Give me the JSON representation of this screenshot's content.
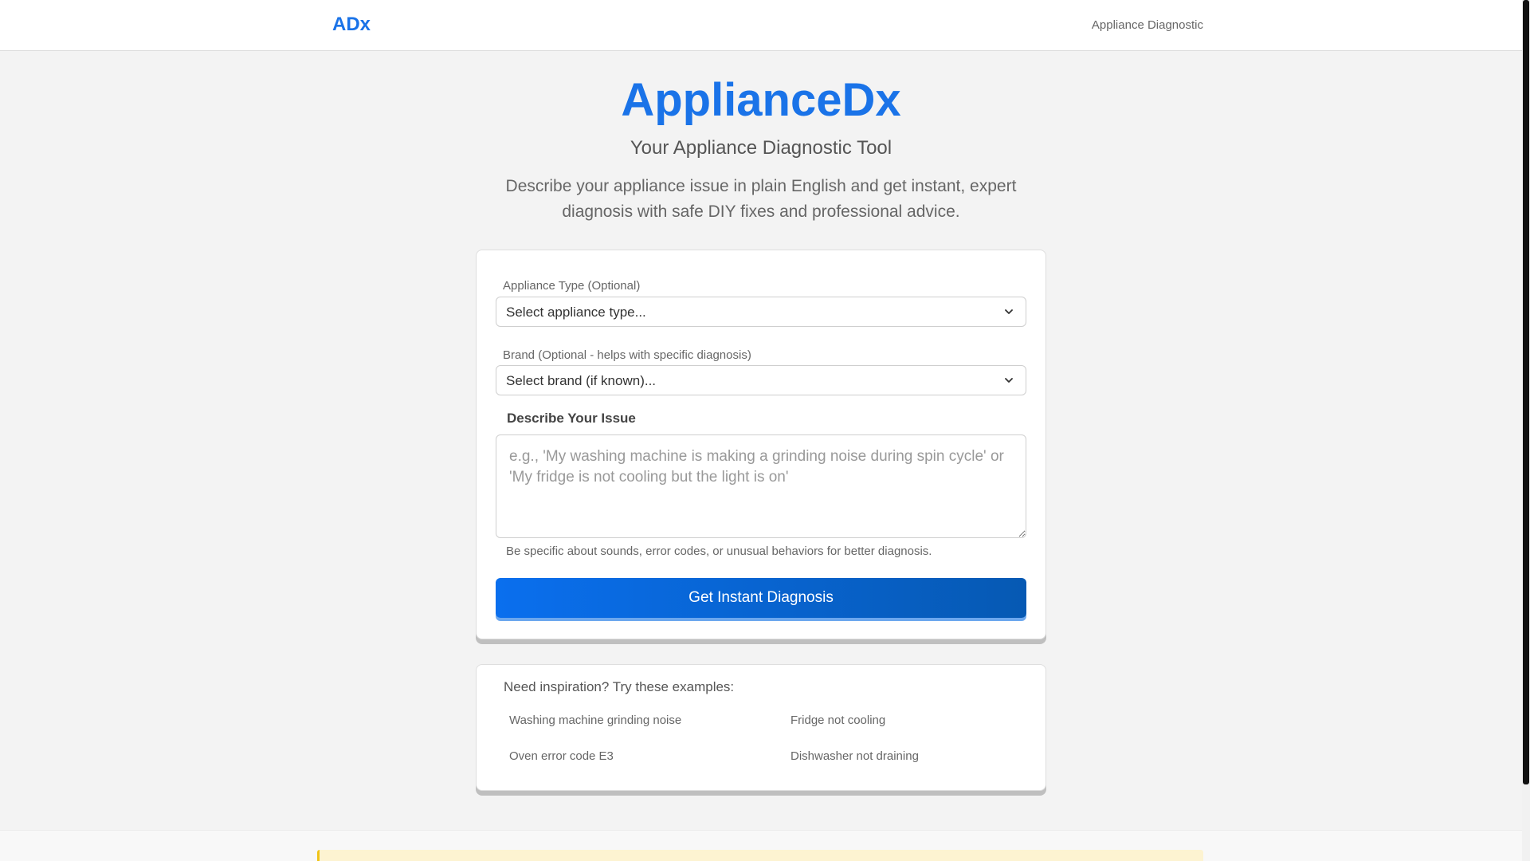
{
  "nav": {
    "brand": "ADx",
    "link": "Appliance Diagnostic"
  },
  "hero": {
    "title": "ApplianceDx",
    "subtitle": "Your Appliance Diagnostic Tool",
    "description": "Describe your appliance issue in plain English and get instant, expert diagnosis with safe DIY fixes and professional advice."
  },
  "form": {
    "appliance_label": "Appliance Type (Optional)",
    "appliance_selected": "Select appliance type...",
    "brand_label": "Brand (Optional - helps with specific diagnosis)",
    "brand_selected": "Select brand (if known)...",
    "issue_label": "Describe Your Issue",
    "issue_placeholder": "e.g., 'My washing machine is making a grinding noise during spin cycle' or 'My fridge is not cooling but the light is on'",
    "issue_value": "",
    "hint": "Be specific about sounds, error codes, or unusual behaviors for better diagnosis.",
    "submit_label": "Get Instant Diagnosis"
  },
  "examples": {
    "title": "Need inspiration? Try these examples:",
    "items": [
      "Washing machine grinding noise",
      "Fridge not cooling",
      "Oven error code E3",
      "Dishwasher not draining"
    ]
  },
  "footer": {
    "warning": ""
  },
  "colors": {
    "accent": "#1a73e8",
    "button_start": "#0a6fee",
    "button_end": "#0659b3",
    "warning_bg": "#fdf3d1",
    "warning_border": "#f0c419"
  },
  "icons": {
    "select_chevron": "chevron-down-icon"
  }
}
